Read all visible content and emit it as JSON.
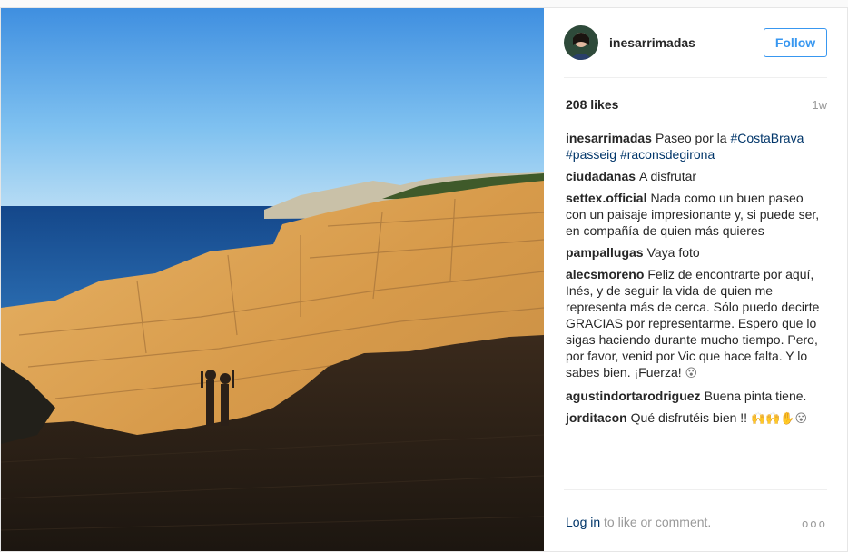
{
  "post": {
    "username": "inesarrimadas",
    "follow_label": "Follow",
    "likes": "208 likes",
    "time_ago": "1w"
  },
  "caption": {
    "user": "inesarrimadas",
    "text": "Paseo por la",
    "tags": [
      "#CostaBrava",
      "#passeig",
      "#raconsdegirona"
    ]
  },
  "comments": [
    {
      "user": "ciudadanas",
      "text": "A disfrutar"
    },
    {
      "user": "settex.official",
      "text": "Nada como un buen paseo con un paisaje impresionante y, si puede ser, en compañía de quien más quieres"
    },
    {
      "user": "pampallugas",
      "text": "Vaya foto"
    },
    {
      "user": "alecsmoreno",
      "text": "Feliz de encontrarte por aquí, Inés, y de seguir la vida de quien me representa más de cerca. Sólo puedo decirte GRACIAS por representarme. Espero que lo sigas haciendo durante mucho tiempo. Pero, por favor, venid por Vic que hace falta. Y lo sabes bien. ¡Fuerza!",
      "emoji": "😮"
    },
    {
      "user": "agustindortarodriguez",
      "text": "Buena pinta tiene."
    },
    {
      "user": "jorditacon",
      "text": "Qué disfrutéis bien !!",
      "emoji": "🙌🙌✋😮"
    }
  ],
  "footer": {
    "login_link": "Log in",
    "login_text": " to like or comment.",
    "more": "ooo"
  },
  "icons": {
    "avatar": "avatar-icon",
    "more": "more-options-icon"
  },
  "colors": {
    "link": "#003569",
    "follow": "#3897f0",
    "sky": "#6aaee8",
    "sea": "#1e5b9a",
    "rock": "#d9a455"
  }
}
